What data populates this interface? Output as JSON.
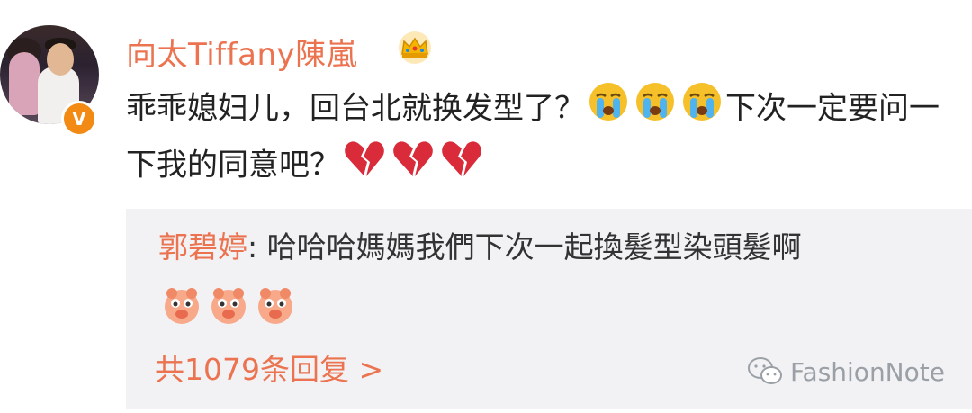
{
  "post": {
    "author": "向太Tiffany陳嵐",
    "verified_badge": "V",
    "text_part1": "乖乖媳妇儿，回台北就换发型了？",
    "text_part2": "下次一定要问一下我的同意吧？",
    "icons": {
      "crown": "crown-icon",
      "crying": "crying-face-emoji",
      "broken_heart": "broken-heart-emoji"
    }
  },
  "reply": {
    "author": "郭碧婷",
    "separator": ": ",
    "text": "哈哈哈媽媽我們下次一起換髮型染頭髮啊",
    "emoji": "pig-emoji",
    "count_label": "共1079条回复 >"
  },
  "watermark": {
    "text": "FashionNote"
  },
  "colors": {
    "accent": "#eb7350",
    "badge": "#f28a14",
    "reply_bg": "#f2f2f5",
    "text": "#222222"
  }
}
